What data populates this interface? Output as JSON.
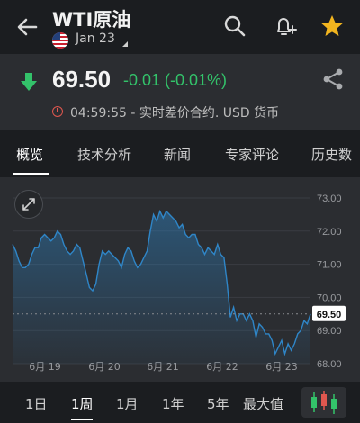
{
  "header": {
    "title": "WTI原油",
    "date_selector": "Jan 23"
  },
  "quote": {
    "price": "69.50",
    "change": "-0.01 (-0.01%)",
    "status": "04:59:55 - 实时差价合约. USD 货币"
  },
  "tabs": [
    "概览",
    "技术分析",
    "新闻",
    "专家评论",
    "历史数"
  ],
  "chart_data": {
    "type": "area",
    "x_labels": [
      "6月 19",
      "6月 20",
      "6月 21",
      "6月 22",
      "6月 23"
    ],
    "y_ticks": [
      "73.00",
      "72.00",
      "71.00",
      "70.00",
      "69.00",
      "68.00"
    ],
    "ylim": [
      68.0,
      73.0
    ],
    "last_price_label": "69.50",
    "series": [
      {
        "values": [
          71.6,
          71.4,
          71.1,
          70.9,
          70.9,
          71.0,
          71.3,
          71.5,
          71.5,
          71.8,
          71.9,
          71.8,
          71.7,
          71.8,
          72.0,
          71.9,
          71.6,
          71.4,
          71.3,
          71.4,
          71.6,
          71.5,
          71.1,
          70.7,
          70.3,
          70.2,
          70.4,
          71.0,
          71.4,
          71.3,
          71.4,
          71.3,
          71.2,
          71.1,
          70.9,
          71.3,
          71.5,
          71.4,
          71.1,
          70.9,
          71.0,
          71.2,
          71.4,
          72.0,
          72.5,
          72.3,
          72.6,
          72.4,
          72.6,
          72.5,
          72.4,
          72.3,
          72.1,
          72.2,
          71.9,
          71.8,
          71.9,
          71.9,
          71.6,
          71.5,
          71.3,
          71.5,
          71.4,
          71.3,
          71.6,
          71.3,
          71.2,
          70.4,
          69.4,
          69.7,
          69.3,
          69.5,
          69.5,
          69.3,
          69.5,
          69.3,
          68.8,
          69.2,
          69.1,
          68.9,
          68.9,
          68.7,
          68.3,
          68.5,
          68.7,
          68.3,
          68.6,
          68.4,
          68.6,
          68.9,
          69.0,
          69.3,
          69.2,
          69.5
        ]
      }
    ]
  },
  "ranges": [
    "1日",
    "1周",
    "1月",
    "1年",
    "5年",
    "最大值"
  ],
  "colors": {
    "up_green": "#33c26a",
    "line_blue": "#2f86c8",
    "star_gold": "#f2b51f"
  },
  "icons": [
    "back-arrow-icon",
    "us-flag-icon",
    "search-icon",
    "add-alert-icon",
    "star-icon",
    "down-arrow-icon",
    "share-icon",
    "clock-icon",
    "expand-icon",
    "candlestick-icon"
  ]
}
